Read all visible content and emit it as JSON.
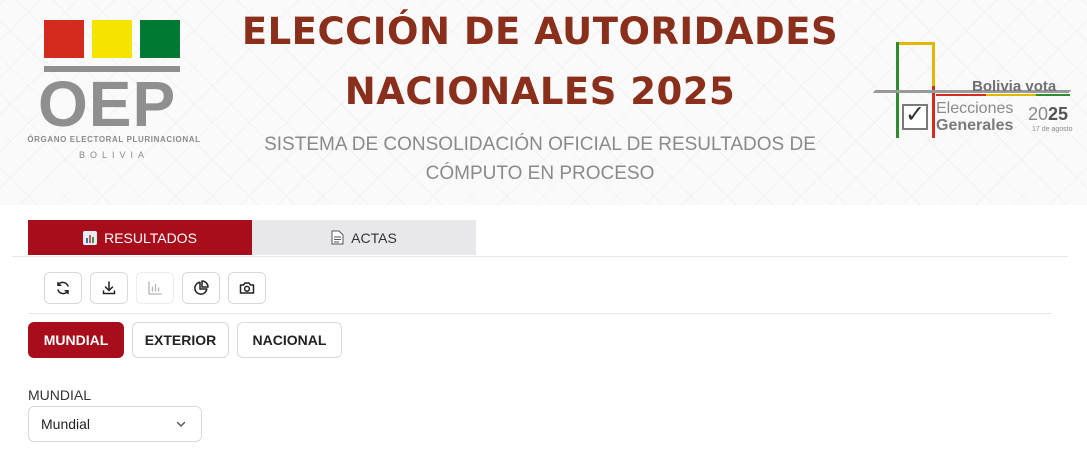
{
  "header": {
    "oep_logo": {
      "text": "OEP",
      "subtitle": "ÓRGANO ELECTORAL PLURINACIONAL",
      "country": "BOLIVIA",
      "flag_colors": [
        "#d52b1e",
        "#f4e400",
        "#007a33"
      ]
    },
    "title_line1": "ELECCIÓN DE AUTORIDADES",
    "title_line2": "NACIONALES 2025",
    "subtitle_line1": "SISTEMA DE CONSOLIDACIÓN OFICIAL DE RESULTADOS DE",
    "subtitle_line2": "CÓMPUTO EN PROCESO",
    "campaign_logo": {
      "tagline": "Bolivia vota",
      "word1": "Elecciones",
      "word2": "Generales",
      "year_prefix": "20",
      "year_suffix": "25",
      "date": "17 de agosto"
    }
  },
  "tabs": [
    {
      "label": "RESULTADOS",
      "icon": "bar-chart-icon",
      "active": true
    },
    {
      "label": "ACTAS",
      "icon": "document-icon",
      "active": false
    }
  ],
  "toolbar": [
    {
      "icon": "refresh-icon",
      "enabled": true
    },
    {
      "icon": "download-icon",
      "enabled": true
    },
    {
      "icon": "bar-chart-icon",
      "enabled": false
    },
    {
      "icon": "pie-chart-icon",
      "enabled": true
    },
    {
      "icon": "camera-icon",
      "enabled": true
    }
  ],
  "scope_buttons": [
    {
      "label": "MUNDIAL",
      "active": true
    },
    {
      "label": "EXTERIOR",
      "active": false
    },
    {
      "label": "NACIONAL",
      "active": false
    }
  ],
  "filter": {
    "label": "MUNDIAL",
    "selected": "Mundial"
  },
  "colors": {
    "accent": "#a80d1b",
    "title": "#8a2f1c",
    "muted": "#8a8a8a"
  }
}
